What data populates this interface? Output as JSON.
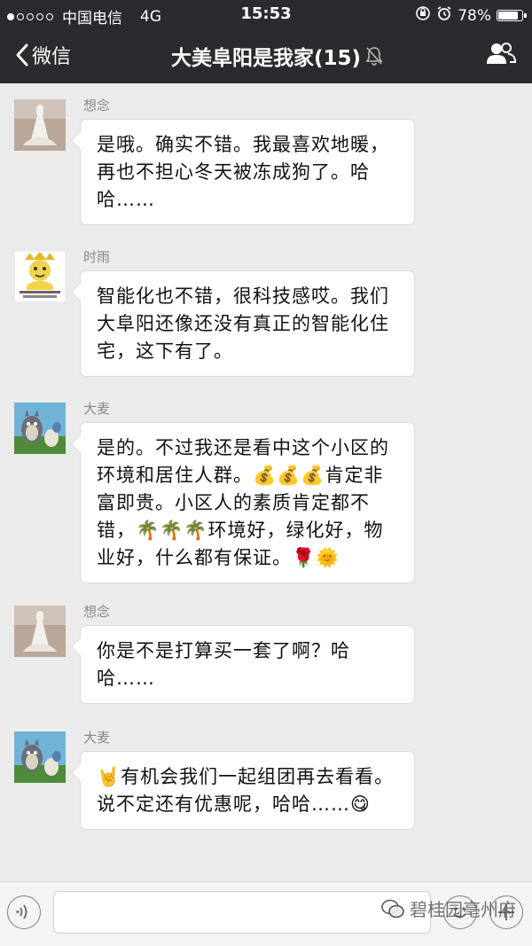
{
  "status_bar": {
    "carrier": "中国电信",
    "network": "4G",
    "time": "15:53",
    "battery_text": "78%",
    "battery_level": 0.78,
    "signal_bars_filled": 1,
    "signal_bars_total": 5
  },
  "nav": {
    "back_label": "微信",
    "title": "大美阜阳是我家(15)"
  },
  "messages": [
    {
      "sender": "想念",
      "text": "是哦。确实不错。我最喜欢地暖，再也不担心冬天被冻成狗了。哈哈……",
      "avatar": "wedding-dress-avatar"
    },
    {
      "sender": "时雨",
      "text": "智能化也不错，很科技感哎。我们大阜阳还像还没有真正的智能化住宅，这下有了。",
      "avatar": "cartoon-meme-avatar"
    },
    {
      "sender": "大麦",
      "text": "是的。不过我还是看中这个小区的环境和居住人群。💰💰💰肯定非富即贵。小区人的素质肯定都不错，🌴🌴🌴环境好，绿化好，物业好，什么都有保证。🌹🌞",
      "avatar": "totoro-avatar"
    },
    {
      "sender": "想念",
      "text": "你是不是打算买一套了啊？哈哈……",
      "avatar": "wedding-dress-avatar"
    },
    {
      "sender": "大麦",
      "text": "🤘有机会我们一起组团再去看看。说不定还有优惠呢，哈哈……😋",
      "avatar": "totoro-avatar"
    }
  ],
  "watermark": "碧桂园亳州府",
  "colors": {
    "nav_bg": "#2b2a2f",
    "chat_bg": "#ebebeb",
    "bubble_bg": "#ffffff"
  }
}
